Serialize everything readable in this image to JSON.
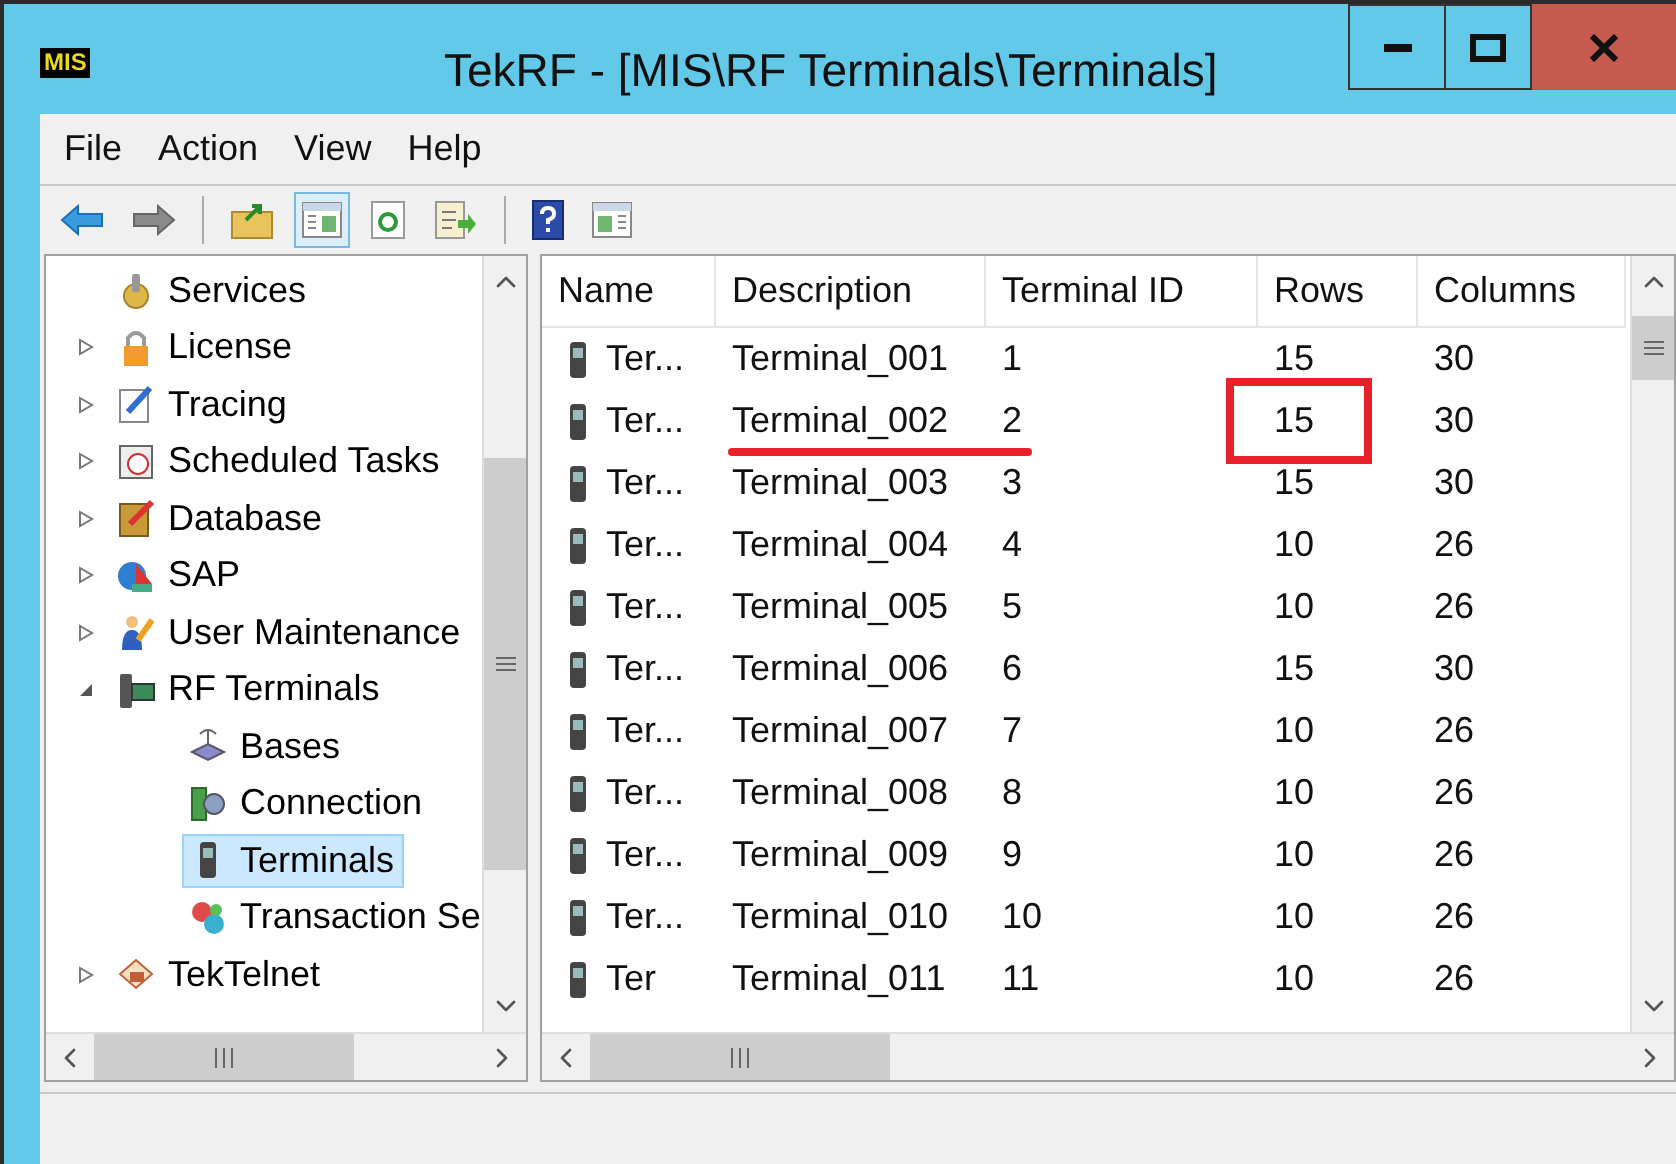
{
  "window": {
    "app_icon_text": "MIS",
    "title": "TekRF - [MIS\\RF Terminals\\Terminals]"
  },
  "menu": [
    "File",
    "Action",
    "View",
    "Help"
  ],
  "toolbar": [
    {
      "kind": "back",
      "selected": false
    },
    {
      "kind": "forward",
      "selected": false
    },
    {
      "kind": "separator"
    },
    {
      "kind": "up",
      "selected": false
    },
    {
      "kind": "tree",
      "selected": true
    },
    {
      "kind": "refresh",
      "selected": false
    },
    {
      "kind": "export",
      "selected": false
    },
    {
      "kind": "separator"
    },
    {
      "kind": "help",
      "selected": false
    },
    {
      "kind": "actionpane",
      "selected": false
    }
  ],
  "tree": [
    {
      "label": "Services",
      "kind": "gear",
      "selected": false
    },
    {
      "label": "License",
      "kind": "lock",
      "selected": false,
      "expanded": false
    },
    {
      "label": "Tracing",
      "kind": "notepad",
      "selected": false,
      "expanded": false
    },
    {
      "label": "Scheduled Tasks",
      "kind": "calendar",
      "selected": false,
      "expanded": false
    },
    {
      "label": "Database",
      "kind": "pencil",
      "selected": false,
      "expanded": false
    },
    {
      "label": "SAP",
      "kind": "globe",
      "selected": false,
      "expanded": false
    },
    {
      "label": "User Maintenance",
      "kind": "user",
      "selected": false,
      "expanded": false
    },
    {
      "label": "RF Terminals",
      "kind": "rfdevice",
      "selected": false,
      "expanded": true,
      "children": [
        {
          "label": "Bases",
          "kind": "router",
          "selected": false
        },
        {
          "label": "Connection",
          "kind": "connection",
          "selected": false
        },
        {
          "label": "Terminals",
          "kind": "handheld",
          "selected": true
        },
        {
          "label": "Transaction Se",
          "kind": "puzzle",
          "selected": false
        }
      ]
    },
    {
      "label": "TekTelnet",
      "kind": "telnet",
      "selected": false,
      "expanded": false
    }
  ],
  "table": {
    "columns": [
      "Name",
      "Description",
      "Terminal ID",
      "Rows",
      "Columns"
    ],
    "rows": [
      {
        "name": "Ter...",
        "description": "Terminal_001",
        "terminal_id": "1",
        "rows": "15",
        "columns": "30",
        "description_underlined": false,
        "rows_boxed": false
      },
      {
        "name": "Ter...",
        "description": "Terminal_002",
        "terminal_id": "2",
        "rows": "15",
        "columns": "30",
        "description_underlined": true,
        "rows_boxed": true
      },
      {
        "name": "Ter...",
        "description": "Terminal_003",
        "terminal_id": "3",
        "rows": "15",
        "columns": "30",
        "description_underlined": false,
        "rows_boxed": false
      },
      {
        "name": "Ter...",
        "description": "Terminal_004",
        "terminal_id": "4",
        "rows": "10",
        "columns": "26",
        "description_underlined": false,
        "rows_boxed": false
      },
      {
        "name": "Ter...",
        "description": "Terminal_005",
        "terminal_id": "5",
        "rows": "10",
        "columns": "26",
        "description_underlined": false,
        "rows_boxed": false
      },
      {
        "name": "Ter...",
        "description": "Terminal_006",
        "terminal_id": "6",
        "rows": "15",
        "columns": "30",
        "description_underlined": false,
        "rows_boxed": false
      },
      {
        "name": "Ter...",
        "description": "Terminal_007",
        "terminal_id": "7",
        "rows": "10",
        "columns": "26",
        "description_underlined": false,
        "rows_boxed": false
      },
      {
        "name": "Ter...",
        "description": "Terminal_008",
        "terminal_id": "8",
        "rows": "10",
        "columns": "26",
        "description_underlined": false,
        "rows_boxed": false
      },
      {
        "name": "Ter...",
        "description": "Terminal_009",
        "terminal_id": "9",
        "rows": "10",
        "columns": "26",
        "description_underlined": false,
        "rows_boxed": false
      },
      {
        "name": "Ter...",
        "description": "Terminal_010",
        "terminal_id": "10",
        "rows": "10",
        "columns": "26",
        "description_underlined": false,
        "rows_boxed": false
      },
      {
        "name": "Ter",
        "description": "Terminal_011",
        "terminal_id": "11",
        "rows": "10",
        "columns": "26",
        "description_underlined": false,
        "rows_boxed": false
      }
    ]
  }
}
